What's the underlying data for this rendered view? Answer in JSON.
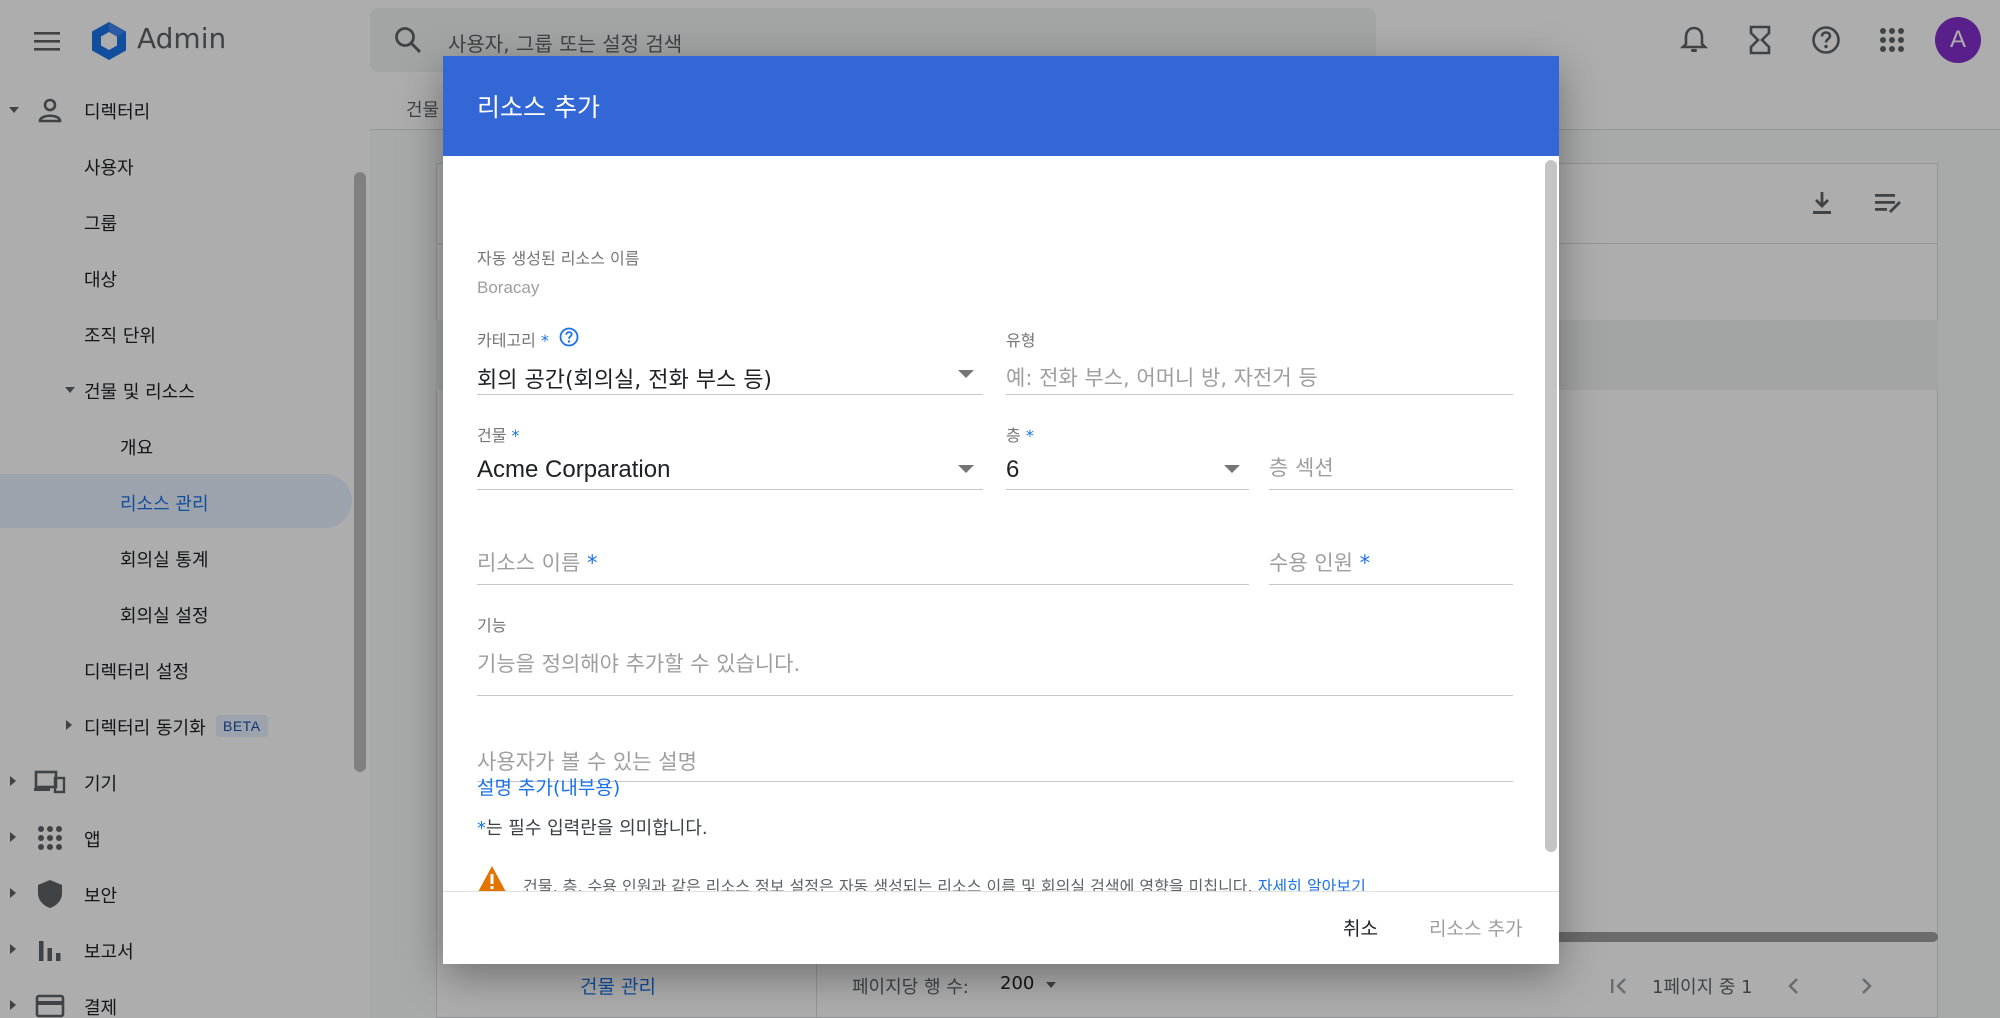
{
  "app": {
    "title": "Admin",
    "avatar_letter": "A"
  },
  "search": {
    "placeholder": "사용자, 그룹 또는 설정 검색"
  },
  "sidebar": {
    "directory": "디렉터리",
    "users": "사용자",
    "groups": "그룹",
    "targets": "대상",
    "org_units": "조직 단위",
    "buildings": "건물 및 리소스",
    "overview": "개요",
    "resource_mgmt": "리소스 관리",
    "room_stats": "회의실 통계",
    "room_settings": "회의실 설정",
    "directory_settings": "디렉터리 설정",
    "directory_sync": "디렉터리 동기화",
    "beta": "BETA",
    "devices": "기기",
    "apps": "앱",
    "security": "보안",
    "reports": "보고서",
    "billing": "결제"
  },
  "main": {
    "tab_partial": "건물",
    "building_mgmt_link": "건물 관리",
    "rows_per_page_label": "페이지당 행 수:",
    "rows_per_page_value": "200",
    "page_info": "1페이지 중 1"
  },
  "dialog": {
    "title": "리소스 추가",
    "auto_name_label": "자동 생성된 리소스 이름",
    "auto_name_value": "Boracay",
    "category_label": "카테고리",
    "category_value": "회의 공간(회의실, 전화 부스 등)",
    "type_label": "유형",
    "type_placeholder": "예: 전화 부스, 어머니 방, 자전거 등",
    "building_label": "건물",
    "building_value": "Acme Corparation",
    "floor_label": "층",
    "floor_value": "6",
    "floor_section_placeholder": "층 섹션",
    "resource_name_placeholder": "리소스 이름",
    "capacity_placeholder": "수용 인원",
    "features_label": "기능",
    "features_placeholder": "기능을 정의해야 추가할 수 있습니다.",
    "user_desc_placeholder": "사용자가 볼 수 있는 설명",
    "add_internal_desc": "설명 추가(내부용)",
    "required_star": "*",
    "required_note": "는 필수 입력란을 의미합니다.",
    "warning_text": "건물, 층, 수용 인원과 같은 리소스 정보 설정은 자동 생성되는 리소스 이름 및 회의실 검색에 영향을 미칩니다.",
    "learn_more": "자세히 알아보기",
    "cancel": "취소",
    "add": "리소스 추가"
  },
  "colors": {
    "dialog_header": "#3367d6",
    "accent": "#1a73e8",
    "warning": "#e37400",
    "avatar": "#8430ce"
  },
  "icons": [
    "menu-icon",
    "admin-logo-icon",
    "search-icon",
    "bell-icon",
    "hourglass-icon",
    "help-icon",
    "apps-grid-icon",
    "person-icon",
    "devices-icon",
    "shield-icon",
    "bar-chart-icon",
    "credit-card-icon",
    "download-icon",
    "filter-list-icon",
    "warning-icon"
  ]
}
